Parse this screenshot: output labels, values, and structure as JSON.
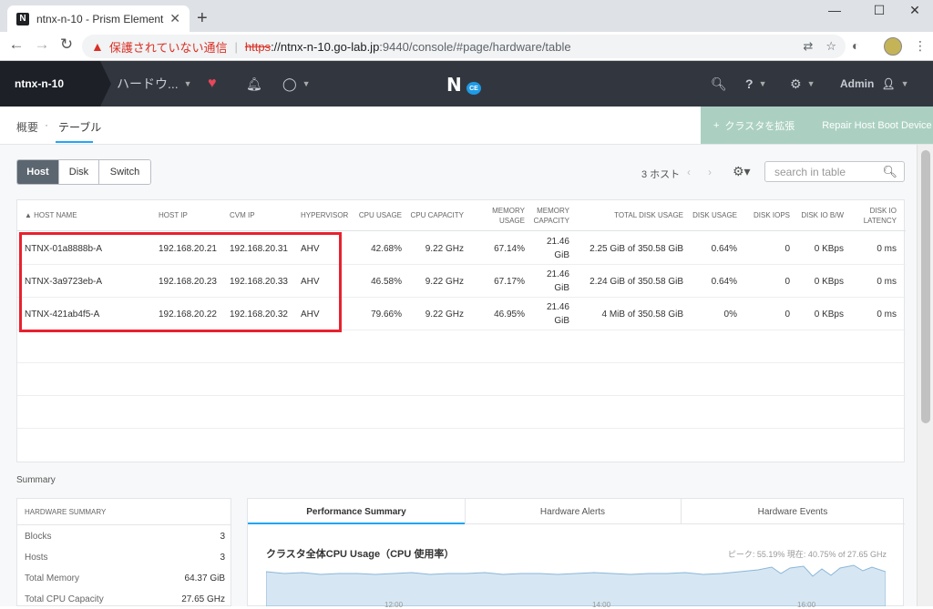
{
  "browser": {
    "tab_title": "ntnx-n-10 - Prism Element",
    "security_warning": "保護されていない通信",
    "url_scheme": "https",
    "url_host": "://ntnx-n-10.go-lab.jp",
    "url_path": ":9440/console/#page/hardware/table"
  },
  "header": {
    "cluster_name": "ntnx-n-10",
    "menu_label": "ハードウ...",
    "help_label": "?",
    "user_label": "Admin",
    "logo_badge": "CE"
  },
  "subnav": {
    "overview": "概要",
    "dot": "·",
    "table": "テーブル",
    "expand_cluster": "クラスタを拡張",
    "repair_label": "Repair Host Boot Device"
  },
  "view_toggle": {
    "host": "Host",
    "disk": "Disk",
    "switch": "Switch"
  },
  "table_controls": {
    "count": "3 ホスト",
    "search_placeholder": "search in table"
  },
  "table": {
    "columns": [
      {
        "label": "▲  HOST NAME"
      },
      {
        "label": "HOST IP"
      },
      {
        "label": "CVM IP"
      },
      {
        "label": "HYPERVISOR"
      },
      {
        "label": "CPU USAGE"
      },
      {
        "label": "CPU CAPACITY"
      },
      {
        "label": "MEMORY USAGE"
      },
      {
        "label": "MEMORY CAPACITY"
      },
      {
        "label": "TOTAL DISK USAGE"
      },
      {
        "label": "DISK USAGE"
      },
      {
        "label": "DISK IOPS"
      },
      {
        "label": "DISK IO B/W"
      },
      {
        "label": "DISK IO LATENCY"
      }
    ],
    "rows": [
      [
        "NTNX-01a8888b-A",
        "192.168.20.21",
        "192.168.20.31",
        "AHV",
        "42.68%",
        "9.22 GHz",
        "67.14%",
        "21.46 GiB",
        "2.25 GiB of 350.58 GiB",
        "0.64%",
        "0",
        "0 KBps",
        "0 ms"
      ],
      [
        "NTNX-3a9723eb-A",
        "192.168.20.23",
        "192.168.20.33",
        "AHV",
        "46.58%",
        "9.22 GHz",
        "67.17%",
        "21.46 GiB",
        "2.24 GiB of 350.58 GiB",
        "0.64%",
        "0",
        "0 KBps",
        "0 ms"
      ],
      [
        "NTNX-421ab4f5-A",
        "192.168.20.22",
        "192.168.20.32",
        "AHV",
        "79.66%",
        "9.22 GHz",
        "46.95%",
        "21.46 GiB",
        "4 MiB of 350.58 GiB",
        "0%",
        "0",
        "0 KBps",
        "0 ms"
      ]
    ]
  },
  "summary": {
    "title": "Summary",
    "hw_header": "HARDWARE SUMMARY",
    "items": [
      {
        "k": "Blocks",
        "v": "3"
      },
      {
        "k": "Hosts",
        "v": "3"
      },
      {
        "k": "Total Memory",
        "v": "64.37 GiB"
      },
      {
        "k": "Total CPU Capacity",
        "v": "27.65 GHz"
      }
    ]
  },
  "performance": {
    "tabs": [
      "Performance Summary",
      "Hardware Alerts",
      "Hardware Events"
    ],
    "chart_title": "クラスタ全体CPU Usage（CPU 使用率）",
    "chart_peak": "ピーク: 55.19%  現在: 40.75% of 27.65 GHz",
    "ticks": [
      "12:00",
      "14:00",
      "16:00"
    ]
  },
  "colors": {
    "header_bg": "#32373f",
    "accent": "#22a5f7",
    "highlight": "#e8212e",
    "action_bar": "#abd0c2"
  }
}
